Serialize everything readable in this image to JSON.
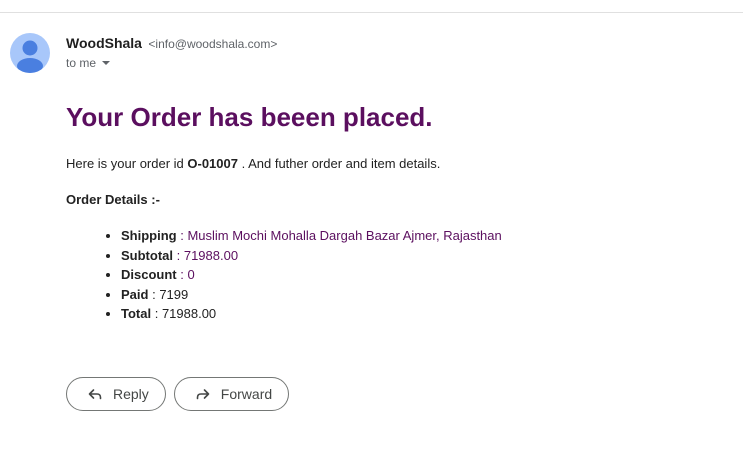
{
  "sender": {
    "name": "WoodShala",
    "email": "<info@woodshala.com>",
    "recipient_label": "to me"
  },
  "email": {
    "headline": "Your Order has beeen placed.",
    "intro_prefix": "Here is your order id ",
    "order_id": "O-01007",
    "intro_suffix": " . And futher order and item details.",
    "section_title": "Order Details :-",
    "details": [
      {
        "label": "Shipping",
        "separator": " : ",
        "value": "Muslim Mochi Mohalla Dargah Bazar Ajmer, Rajasthan"
      },
      {
        "label": "Subtotal",
        "separator": " : ",
        "value": "71988.00"
      },
      {
        "label": "Discount",
        "separator": " : ",
        "value": "0"
      },
      {
        "label": "Paid",
        "separator": " : ",
        "value": "7199"
      },
      {
        "label": "Total",
        "separator": " : ",
        "value": "71988.00"
      }
    ]
  },
  "actions": {
    "reply_label": "Reply",
    "forward_label": "Forward"
  },
  "icons": {
    "avatar": "person-avatar-icon",
    "caret": "caret-down-icon",
    "reply": "reply-arrow-icon",
    "forward": "forward-arrow-icon"
  },
  "colors": {
    "headline": "#5b0f5f",
    "avatar_bg": "#a8c7fa",
    "avatar_fg": "#4a7fe0"
  }
}
